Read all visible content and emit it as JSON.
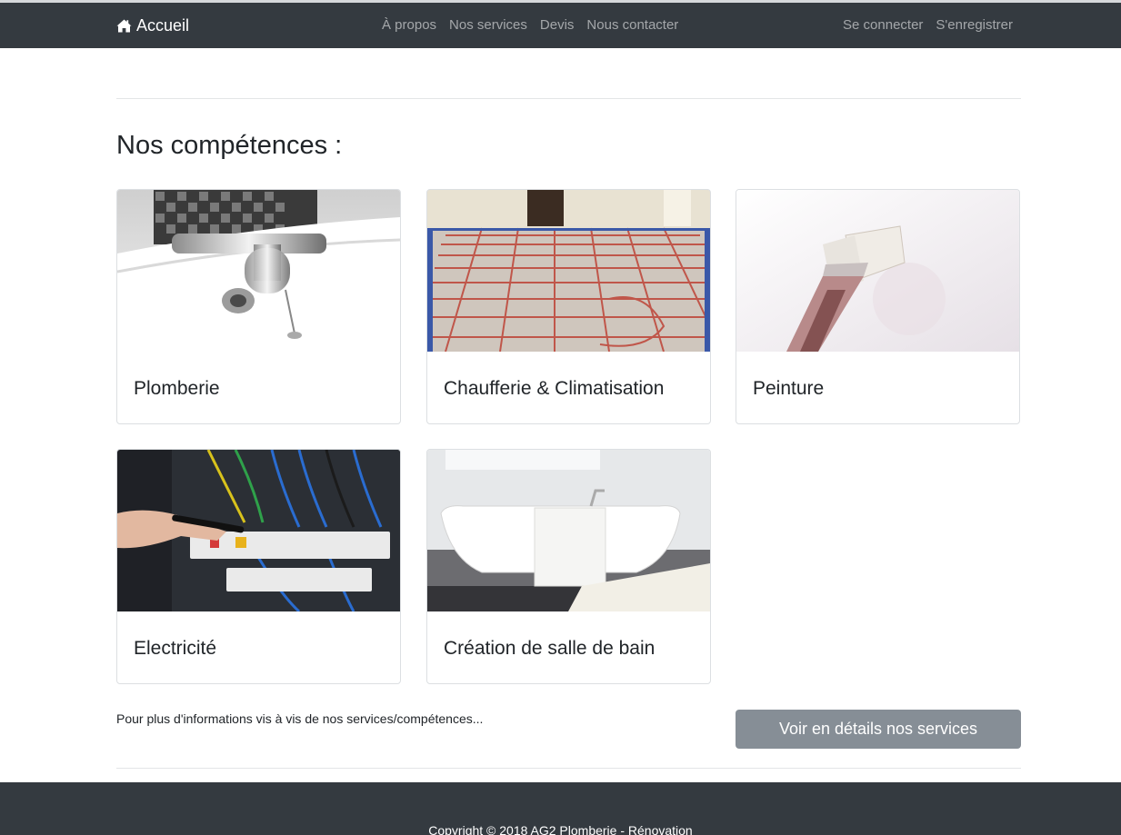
{
  "navbar": {
    "brand_label": "Accueil",
    "brand_icon": "home-icon",
    "links": [
      "À propos",
      "Nos services",
      "Devis",
      "Nous contacter"
    ],
    "auth": {
      "login": "Se connecter",
      "register": "S'enregistrer"
    }
  },
  "main": {
    "section_title": "Nos compétences :",
    "services": [
      {
        "title": "Plomberie",
        "image": "bathtub-faucet-image"
      },
      {
        "title": "Chaufferie & Climatisation",
        "image": "underfloor-heating-image"
      },
      {
        "title": "Peinture",
        "image": "paintbrush-image"
      },
      {
        "title": "Electricité",
        "image": "electrical-panel-image"
      },
      {
        "title": "Création de salle de bain",
        "image": "freestanding-bathtub-image"
      }
    ],
    "more_info_text": "Pour plus d'informations vis à vis de nos services/compétences...",
    "details_button": "Voir en détails nos services"
  },
  "footer": {
    "copyright": "Copyright © 2018 AG2 Plomberie - Rénovation"
  },
  "colors": {
    "navbar_bg": "#343a40",
    "button_bg": "#868e96",
    "nav_link": "#9a9da0"
  }
}
